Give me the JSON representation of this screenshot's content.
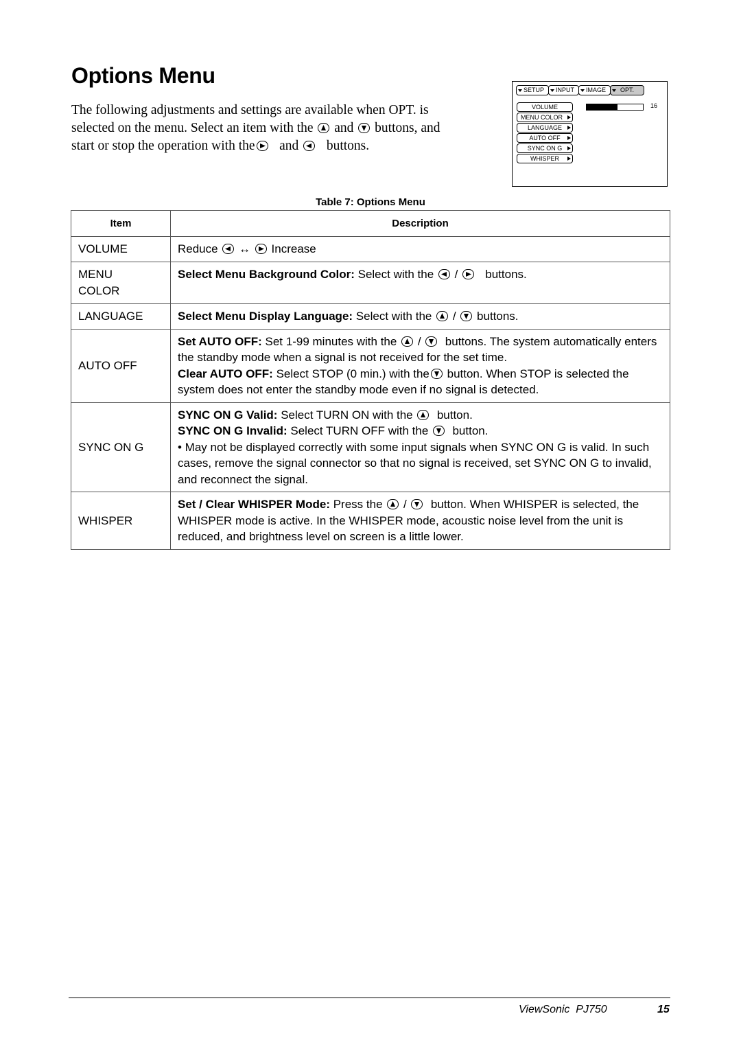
{
  "page": {
    "title": "Options Menu",
    "intro": {
      "line1": "The following adjustments and settings are available when OPT. is",
      "line2a": "selected on the menu. Select an item with the",
      "and1": "and",
      "line2b": "buttons, and",
      "line3a": "start or stop the operation with the",
      "and2": "and",
      "line3b": "buttons."
    }
  },
  "osd": {
    "tabs": [
      {
        "label": "SETUP",
        "active": false
      },
      {
        "label": "INPUT",
        "active": false
      },
      {
        "label": "IMAGE",
        "active": false
      },
      {
        "label": "OPT.",
        "active": true
      }
    ],
    "items": [
      "VOLUME",
      "MENU COLOR",
      "LANGUAGE",
      "AUTO OFF",
      "SYNC ON G",
      "WHISPER"
    ],
    "volume_value": "16",
    "volume_level_fraction": 0.55
  },
  "table": {
    "caption": "Table 7: Options Menu",
    "headers": {
      "item": "Item",
      "description": "Description"
    },
    "rows": {
      "volume": {
        "item": "VOLUME",
        "reduce": "Reduce",
        "arrow": "↔",
        "increase": "Increase"
      },
      "menu_color": {
        "item_l1": "MENU",
        "item_l2": "COLOR",
        "bold": "Select Menu Background Color:",
        "text": "Select with the",
        "slash": "/",
        "tail": "buttons."
      },
      "language": {
        "item": "LANGUAGE",
        "bold": "Select Menu Display Language:",
        "text": "Select with the",
        "slash": "/",
        "tail": "buttons."
      },
      "auto_off": {
        "item": "AUTO OFF",
        "bold1": "Set AUTO OFF:",
        "text1": "Set 1-99 minutes with the",
        "slash": "/",
        "text1b": "buttons. The system automatically enters the standby mode when a signal is not received for the set time.",
        "bold2": "Clear AUTO OFF:",
        "text2": "Select STOP (0 min.) with the",
        "text2b": "button. When STOP is selected the system does not enter the standby mode even if no signal is detected."
      },
      "sync_on_g": {
        "item": "SYNC ON G",
        "bold1": "SYNC ON G Valid:",
        "text1": "Select TURN ON with the",
        "text1b": "button.",
        "bold2": "SYNC ON G Invalid:",
        "text2": "Select TURN OFF with the",
        "text2b": "button.",
        "note": "• May not be displayed correctly with some input signals when SYNC ON G is valid. In such cases, remove the signal connector so that no signal is received, set SYNC ON G to invalid, and reconnect the signal."
      },
      "whisper": {
        "item": "WHISPER",
        "bold": "Set / Clear WHISPER Mode:",
        "text": "Press the",
        "slash": "/",
        "tail": "button. When WHISPER is selected, the WHISPER mode is active. In the WHISPER mode, acoustic noise level from the unit is reduced, and brightness level on screen is a little lower."
      }
    }
  },
  "footer": {
    "brand": "ViewSonic  PJ750",
    "page_number": "15"
  }
}
